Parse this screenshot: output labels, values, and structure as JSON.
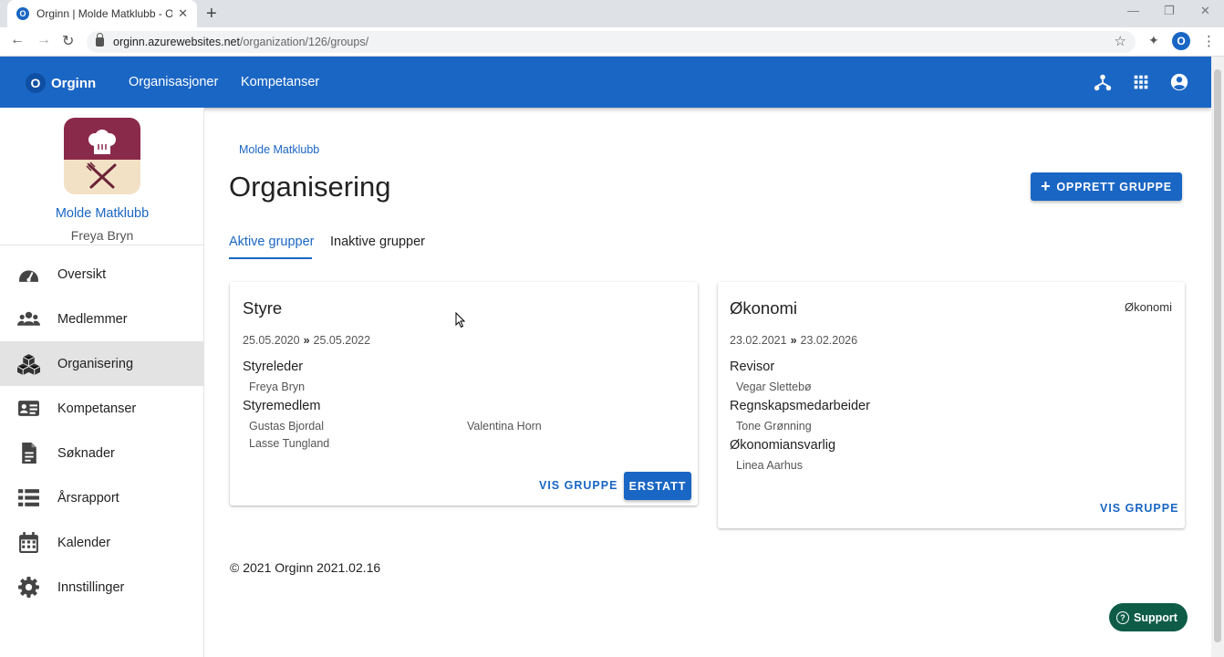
{
  "browser": {
    "tab_title": "Orginn | Molde Matklubb - Orga",
    "favicon_letter": "O",
    "url_host": "orginn.azurewebsites.net",
    "url_path": "/organization/126/groups/",
    "profile_letter": "O"
  },
  "appbar": {
    "brand_letter": "O",
    "brand": "Orginn",
    "nav": [
      "Organisasjoner",
      "Kompetanser"
    ],
    "icons": [
      "org-chart-icon",
      "apps-grid-icon",
      "account-icon"
    ],
    "color": "#1a66c4"
  },
  "sidebar": {
    "org_name": "Molde Matklubb",
    "user_name": "Freya Bryn",
    "items": [
      {
        "label": "Oversikt",
        "icon": "dashboard-icon"
      },
      {
        "label": "Medlemmer",
        "icon": "people-icon"
      },
      {
        "label": "Organisering",
        "icon": "boxes-icon",
        "active": true
      },
      {
        "label": "Kompetanser",
        "icon": "id-card-icon"
      },
      {
        "label": "Søknader",
        "icon": "document-icon"
      },
      {
        "label": "Årsrapport",
        "icon": "list-icon"
      },
      {
        "label": "Kalender",
        "icon": "calendar-icon"
      },
      {
        "label": "Innstillinger",
        "icon": "gear-icon"
      }
    ]
  },
  "main": {
    "breadcrumb": "Molde Matklubb",
    "title": "Organisering",
    "create_button": "OPPRETT GRUPPE",
    "tabs": [
      "Aktive grupper",
      "Inaktive grupper"
    ],
    "cards": [
      {
        "title": "Styre",
        "tag": "",
        "start": "25.05.2020",
        "end": "25.05.2022",
        "roles": [
          {
            "role": "Styreleder",
            "members": [
              "Freya Bryn"
            ]
          },
          {
            "role": "Styremedlem",
            "members": [
              "Gustas Bjordal",
              "Valentina Horn",
              "Lasse Tungland"
            ]
          }
        ],
        "view_button": "VIS GRUPPE",
        "replace_button": "ERSTATT"
      },
      {
        "title": "Økonomi",
        "tag": "Økonomi",
        "start": "23.02.2021",
        "end": "23.02.2026",
        "roles": [
          {
            "role": "Revisor",
            "members": [
              "Vegar Slettebø"
            ]
          },
          {
            "role": "Regnskapsmedarbeider",
            "members": [
              "Tone Grønning"
            ]
          },
          {
            "role": "Økonomiansvarlig",
            "members": [
              "Linea Aarhus"
            ]
          }
        ],
        "view_button": "VIS GRUPPE"
      }
    ],
    "footer": "© 2021 Orginn 2021.02.16",
    "support": "Support"
  }
}
